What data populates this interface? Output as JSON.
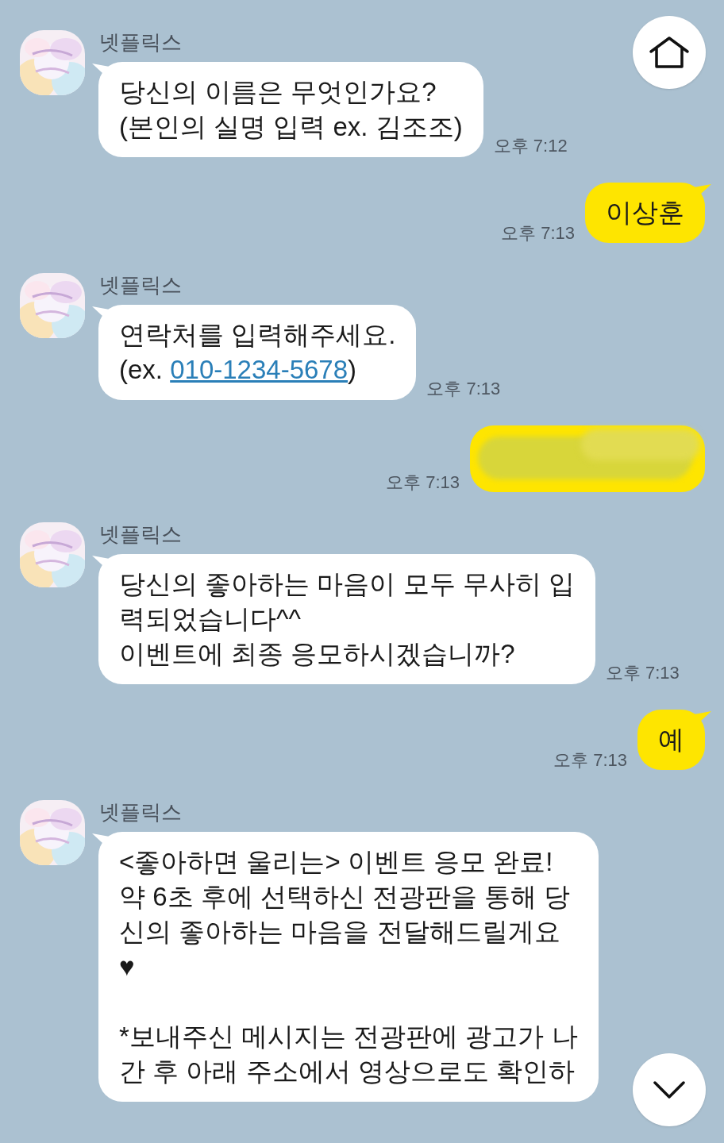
{
  "messages": [
    {
      "kind": "received",
      "sender": "넷플릭스",
      "avatar": {
        "kind": "picture"
      },
      "paragraphs": [
        [
          "당신의 이름은 무엇인가요?",
          "(본인의 실명 입력 ex. 김조조)"
        ]
      ],
      "time": "오후 7:12"
    },
    {
      "kind": "sent",
      "paragraphs": [
        [
          "이상훈"
        ]
      ],
      "time": "오후 7:13"
    },
    {
      "kind": "received",
      "sender": "넷플릭스",
      "avatar": {
        "kind": "picture"
      },
      "paragraphs": [
        [
          "연락처를 입력해주세요.",
          {
            "parts": [
              {
                "kind": "plain",
                "text": "(ex. "
              },
              {
                "kind": "link",
                "text": "010-1234-5678"
              },
              {
                "kind": "plain",
                "text": ")"
              }
            ]
          }
        ]
      ],
      "time": "오후 7:13"
    },
    {
      "kind": "redacted",
      "time": "오후 7:13"
    },
    {
      "kind": "received",
      "sender": "넷플릭스",
      "avatar": {
        "kind": "picture"
      },
      "paragraphs": [
        [
          "당신의 좋아하는 마음이 모두 무사히 입",
          "력되었습니다^^",
          "이벤트에 최종 응모하시겠습니까?"
        ]
      ],
      "time": "오후 7:13"
    },
    {
      "kind": "sent",
      "paragraphs": [
        [
          "예"
        ]
      ],
      "time": "오후 7:13"
    },
    {
      "kind": "received",
      "sender": "넷플릭스",
      "avatar": {
        "kind": "picture"
      },
      "paragraphs": [
        [
          "<좋아하면 울리는> 이벤트 응모 완료!",
          "약 6초 후에 선택하신 전광판을 통해 당",
          "신의 좋아하는 마음을 전달해드릴게요",
          "♥"
        ],
        [
          "*보내주신 메시지는 전광판에 광고가 나",
          "간 후 아래 주소에서 영상으로도 확인하"
        ]
      ]
    }
  ],
  "home_button": {
    "kind": "home"
  },
  "scroll_down_button": {
    "kind": "down"
  }
}
